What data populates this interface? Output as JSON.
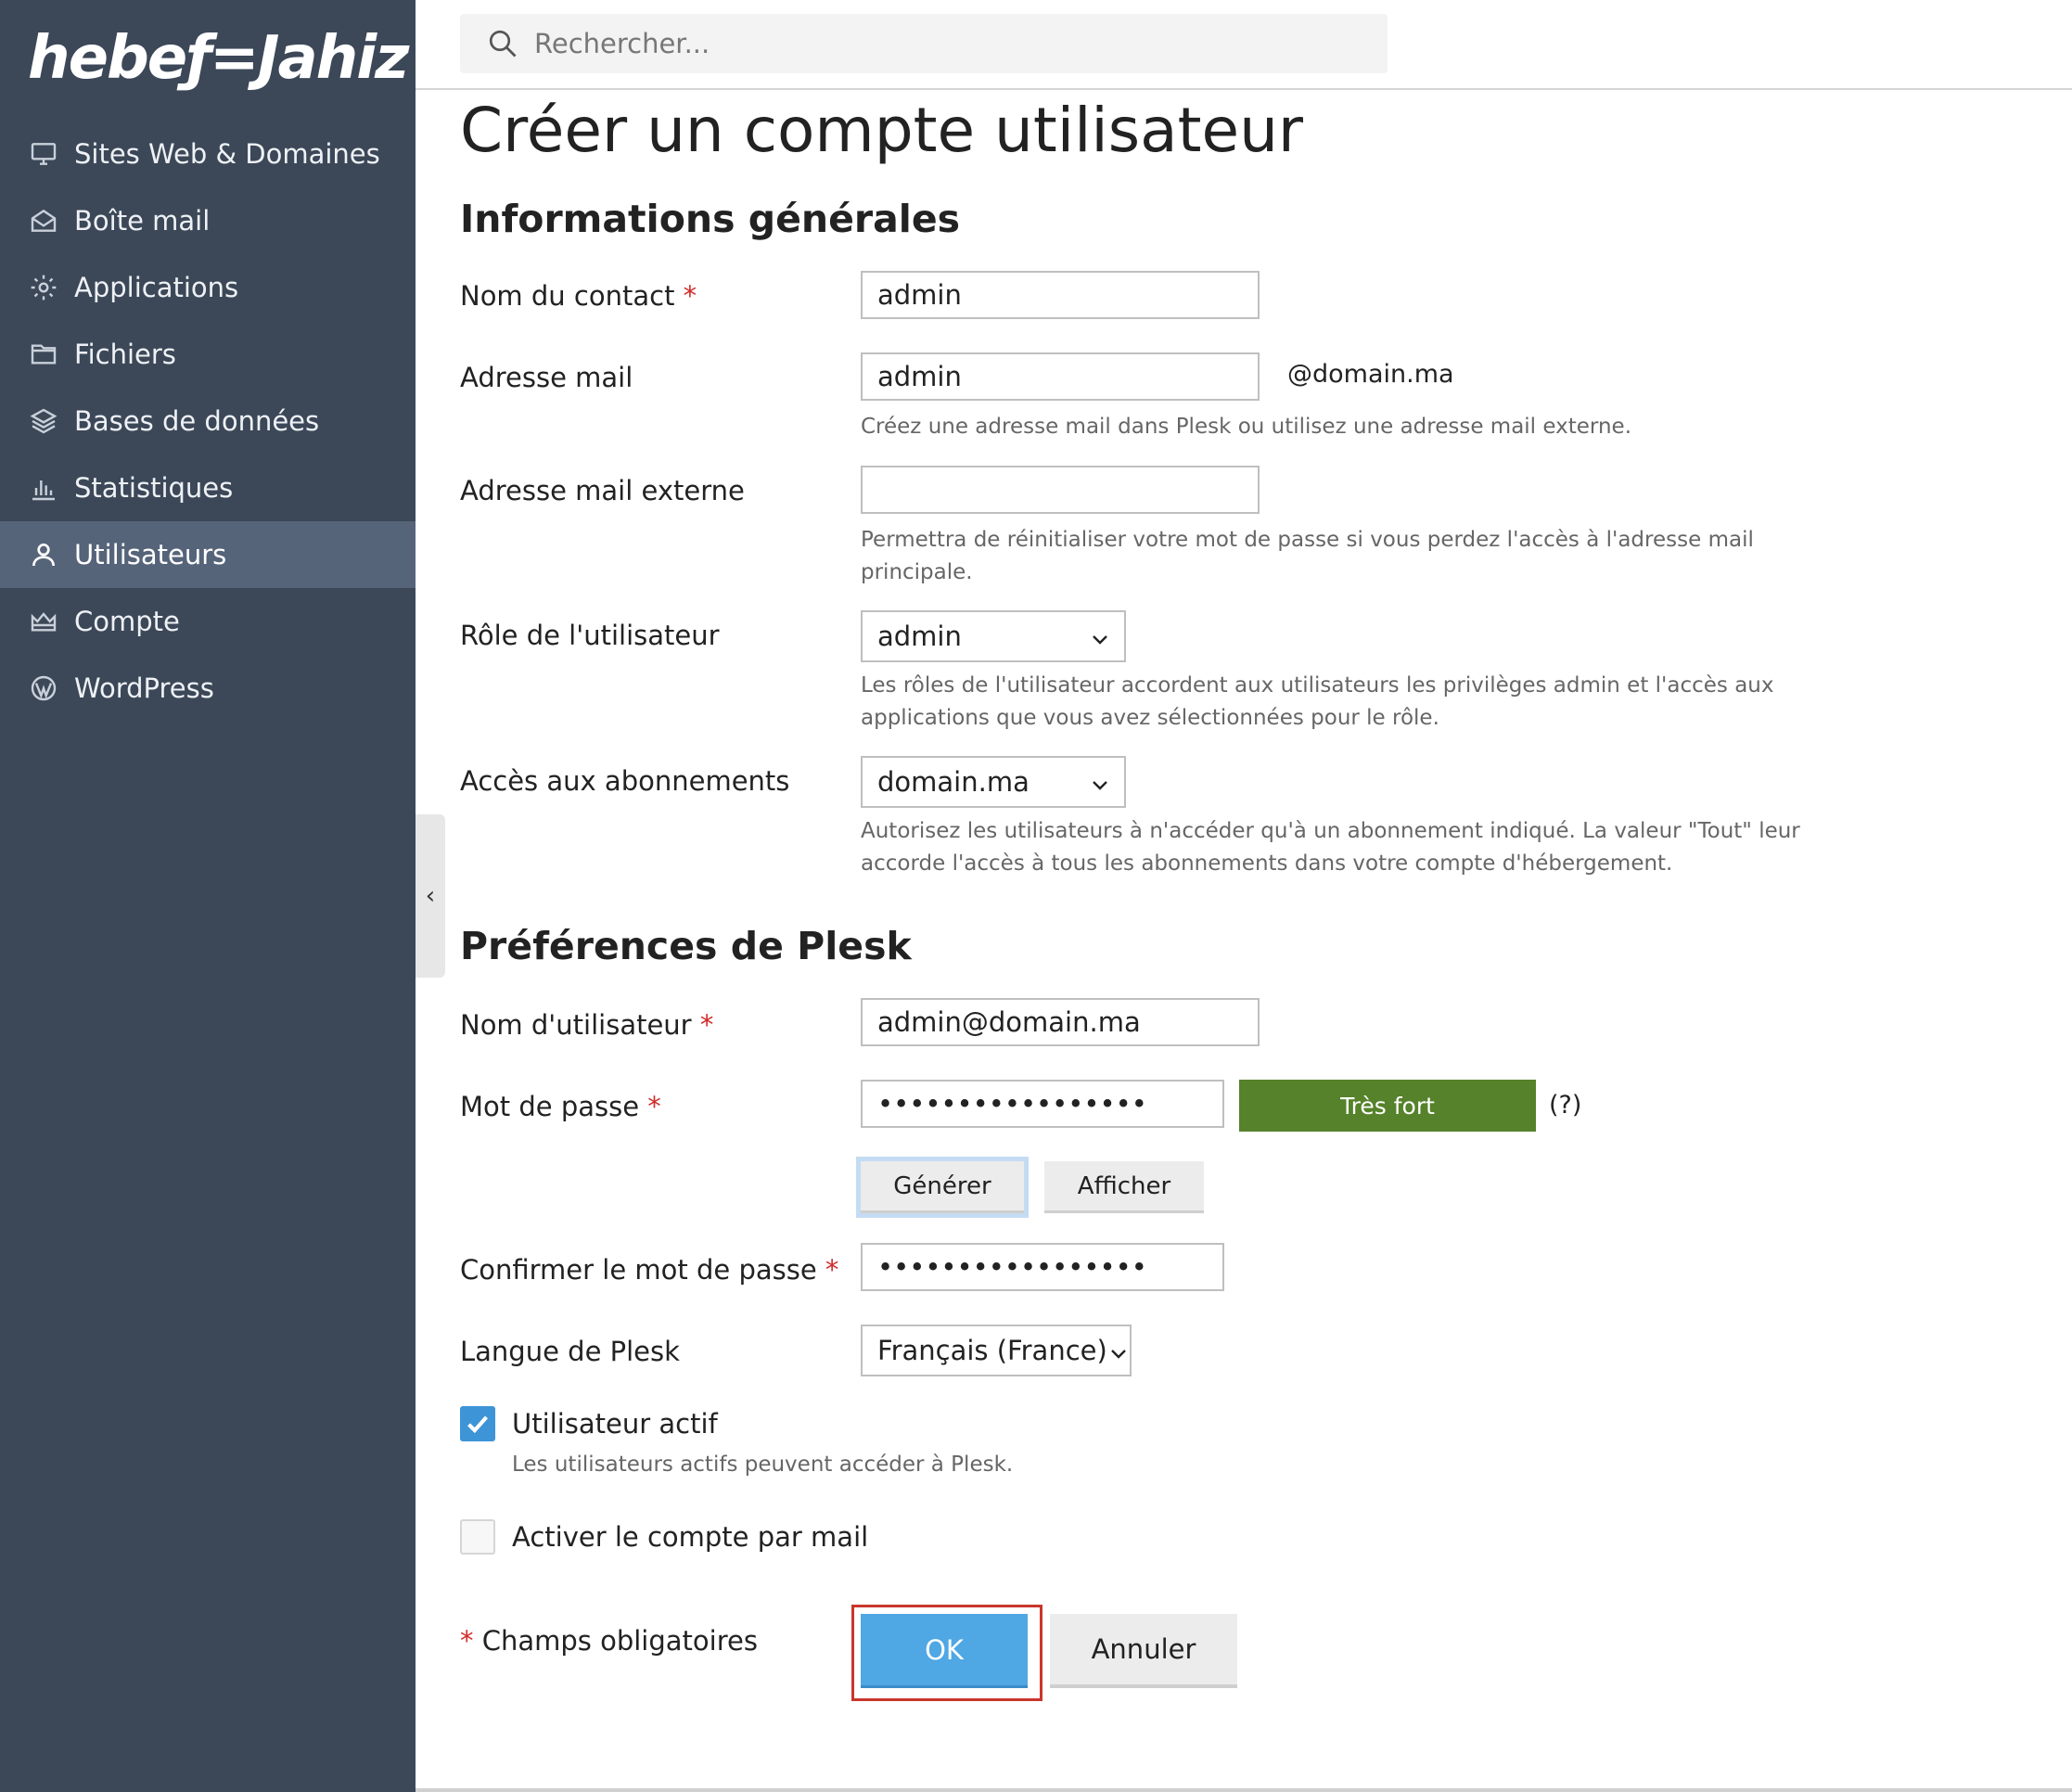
{
  "brand": {
    "logo_text": "hebeƒ=Jahiz"
  },
  "sidebar": {
    "items": [
      {
        "label": "Sites Web & Domaines",
        "icon": "monitor-icon"
      },
      {
        "label": "Boîte mail",
        "icon": "mailbox-icon"
      },
      {
        "label": "Applications",
        "icon": "gear-icon"
      },
      {
        "label": "Fichiers",
        "icon": "folder-icon"
      },
      {
        "label": "Bases de données",
        "icon": "layers-icon"
      },
      {
        "label": "Statistiques",
        "icon": "bar-chart-icon"
      },
      {
        "label": "Utilisateurs",
        "icon": "user-icon",
        "active": true
      },
      {
        "label": "Compte",
        "icon": "crown-icon"
      },
      {
        "label": "WordPress",
        "icon": "wordpress-icon"
      }
    ]
  },
  "search": {
    "placeholder": "Rechercher..."
  },
  "page": {
    "title": "Créer un compte utilisateur"
  },
  "general": {
    "title": "Informations générales",
    "contact_name": {
      "label": "Nom du contact",
      "required": "*",
      "value": "admin"
    },
    "email": {
      "label": "Adresse mail",
      "value": "admin",
      "suffix": "@domain.ma",
      "hint": "Créez une adresse mail dans Plesk ou utilisez une adresse mail externe."
    },
    "external_email": {
      "label": "Adresse mail externe",
      "value": "",
      "hint_line1": "Permettra de réinitialiser votre mot de passe si vous perdez l'accès à l'adresse mail",
      "hint_line2": "principale."
    },
    "role": {
      "label": "Rôle de l'utilisateur",
      "value": "admin",
      "hint_line1": "Les rôles de l'utilisateur accordent aux utilisateurs les privilèges admin et l'accès aux",
      "hint_line2": "applications que vous avez sélectionnées pour le rôle."
    },
    "subscriptions": {
      "label": "Accès aux abonnements",
      "value": "domain.ma",
      "hint_line1": "Autorisez les utilisateurs à n'accéder qu'à un abonnement indiqué. La valeur \"Tout\" leur",
      "hint_line2": "accorde l'accès à tous les abonnements dans votre compte d'hébergement."
    }
  },
  "plesk": {
    "title": "Préférences de Plesk",
    "username": {
      "label": "Nom d'utilisateur",
      "required": "*",
      "value": "admin@domain.ma"
    },
    "password": {
      "label": "Mot de passe",
      "required": "*",
      "value": "•••••••••••••••••",
      "strength": "Très fort",
      "help": "(?)",
      "generate": "Générer",
      "show": "Afficher"
    },
    "confirm": {
      "label": "Confirmer le mot de passe",
      "required": "*",
      "value": "•••••••••••••••••"
    },
    "language": {
      "label": "Langue de Plesk",
      "value": "Français (France)"
    },
    "active": {
      "label": "Utilisateur actif",
      "checked": true,
      "hint": "Les utilisateurs actifs peuvent accéder à Plesk."
    },
    "activate_mail": {
      "label": "Activer le compte par mail",
      "checked": false
    }
  },
  "footer": {
    "required_mark": "*",
    "required_note": " Champs obligatoires",
    "ok": "OK",
    "cancel": "Annuler"
  },
  "colors": {
    "sidebar_bg": "#3c4858",
    "sidebar_active": "#56647a",
    "strength_bg": "#55822a",
    "primary": "#4fa7e4",
    "required": "#d02b2b",
    "highlight_outline": "#c9362b"
  }
}
